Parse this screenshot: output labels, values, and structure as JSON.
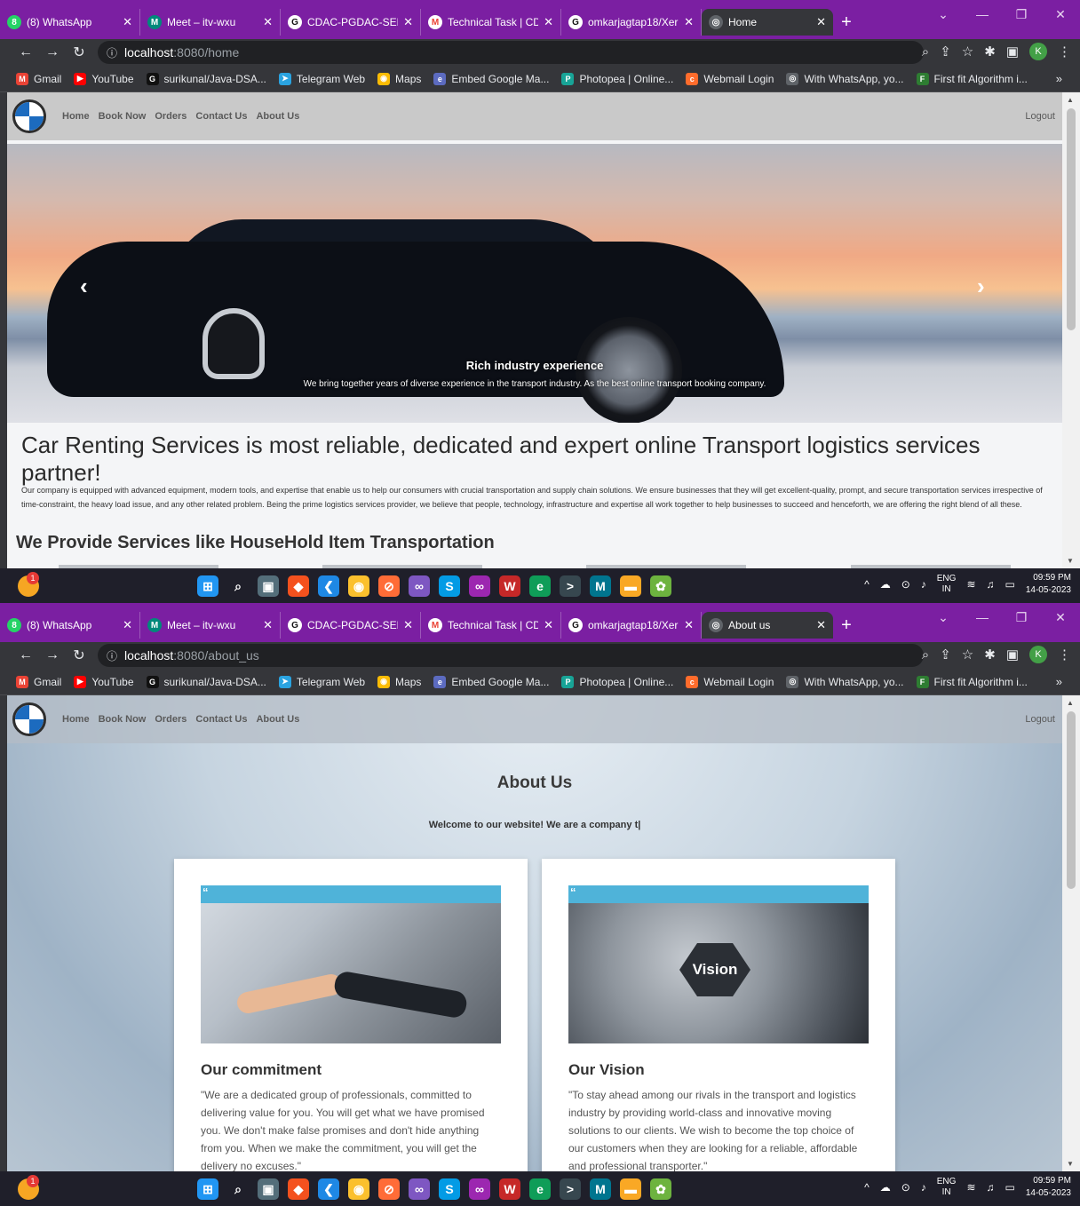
{
  "tabs": [
    {
      "title": "(8) WhatsApp",
      "icon": "whatsapp-icon",
      "color": "#25d366",
      "glyph": "8"
    },
    {
      "title": "Meet – itv-wxu",
      "icon": "meet-icon",
      "color": "#00897b",
      "glyph": "M"
    },
    {
      "title": "CDAC-PGDAC-SEPT",
      "icon": "github-icon",
      "color": "#111111",
      "glyph": "G"
    },
    {
      "title": "Technical Task | CD",
      "icon": "gmail-icon",
      "color": "#ea4335",
      "glyph": "M"
    },
    {
      "title": "omkarjagtap18/Xer",
      "icon": "github-icon",
      "color": "#111111",
      "glyph": "G"
    }
  ],
  "screens": {
    "home": {
      "active_tab": "Home",
      "url_host": "localhost",
      "url_path": ":8080/home"
    },
    "about": {
      "active_tab": "About us",
      "url_host": "localhost",
      "url_path": ":8080/about_us"
    }
  },
  "bookmarks": [
    {
      "label": "Gmail",
      "icon": "gmail-icon",
      "color": "#ea4335",
      "glyph": "M"
    },
    {
      "label": "YouTube",
      "icon": "youtube-icon",
      "color": "#ff0000",
      "glyph": "▶"
    },
    {
      "label": "surikunal/Java-DSA...",
      "icon": "github-icon",
      "color": "#111111",
      "glyph": "G"
    },
    {
      "label": "Telegram Web",
      "icon": "telegram-icon",
      "color": "#2aa3e0",
      "glyph": "➤"
    },
    {
      "label": "Maps",
      "icon": "maps-icon",
      "color": "#fbbc05",
      "glyph": "◉"
    },
    {
      "label": "Embed Google Ma...",
      "icon": "embed-icon",
      "color": "#5c6bc0",
      "glyph": "e"
    },
    {
      "label": "Photopea | Online...",
      "icon": "photopea-icon",
      "color": "#18a497",
      "glyph": "P"
    },
    {
      "label": "Webmail Login",
      "icon": "cpanel-icon",
      "color": "#ff6c2c",
      "glyph": "c"
    },
    {
      "label": "With WhatsApp, yo...",
      "icon": "globe-icon",
      "color": "#5f6368",
      "glyph": "◎"
    },
    {
      "label": "First fit Algorithm i...",
      "icon": "firstfit-icon",
      "color": "#2e7d32",
      "glyph": "F"
    }
  ],
  "site_nav": {
    "links": [
      "Home",
      "Book Now",
      "Orders",
      "Contact Us",
      "About Us"
    ],
    "logout": "Logout"
  },
  "home": {
    "carousel_title": "Rich industry experience",
    "carousel_text": "We bring together years of diverse experience in the transport industry. As the best online transport booking company.",
    "headline": "Car Renting Services is most reliable, dedicated and expert online Transport logistics services partner!",
    "paragraph": "Our company is equipped with advanced equipment, modern tools, and expertise that enable us to help our consumers with crucial transportation and supply chain solutions. We ensure businesses that they will get excellent-quality, prompt, and secure transportation services irrespective of time-constraint, the heavy load issue, and any other related problem. Being the prime logistics services provider, we believe that people, technology, infrastructure and expertise all work together to help businesses to succeed and henceforth, we are offering the right blend of all these.",
    "services_heading": "We Provide Services like HouseHold Item Transportation"
  },
  "about": {
    "title": "About Us",
    "welcome": "Welcome to our website! We are a company t|",
    "cards": [
      {
        "heading": "Our commitment",
        "text": "\"We are a dedicated group of professionals, committed to delivering value for you. You will get what we have promised you. We don't make false promises and don't hide anything from you. When we make the commitment, you will get the delivery no excuses.\""
      },
      {
        "heading": "Our Vision",
        "text": "\"To stay ahead among our rivals in the transport and logistics industry by providing world-class and innovative moving solutions to our clients. We wish to become the top choice of our customers when they are looking for a reliable, affordable and professional transporter.\"",
        "image_label": "Vision"
      }
    ]
  },
  "taskbar": {
    "badge": "1",
    "lang_top": "ENG",
    "lang_bottom": "IN",
    "time": "09:59 PM",
    "date": "14-05-2023",
    "icons": [
      {
        "name": "windows-start-icon",
        "color": "#2196f3",
        "glyph": "⊞"
      },
      {
        "name": "search-icon",
        "color": "transparent",
        "glyph": "⌕"
      },
      {
        "name": "task-view-icon",
        "color": "#546e7a",
        "glyph": "▣"
      },
      {
        "name": "git-icon",
        "color": "#f4511e",
        "glyph": "◆"
      },
      {
        "name": "vscode-icon",
        "color": "#1e88e5",
        "glyph": "❮"
      },
      {
        "name": "chrome-icon",
        "color": "#fbc02d",
        "glyph": "◉"
      },
      {
        "name": "postman-icon",
        "color": "#ff6c37",
        "glyph": "⊘"
      },
      {
        "name": "visual-studio-icon",
        "color": "#7e57c2",
        "glyph": "∞"
      },
      {
        "name": "skype-icon",
        "color": "#039be5",
        "glyph": "S"
      },
      {
        "name": "vs-preview-icon",
        "color": "#9c27b0",
        "glyph": "∞"
      },
      {
        "name": "wamp-icon",
        "color": "#c62828",
        "glyph": "W"
      },
      {
        "name": "edge-icon",
        "color": "#0f9d58",
        "glyph": "e"
      },
      {
        "name": "terminal-icon",
        "color": "#37474f",
        "glyph": ">"
      },
      {
        "name": "mysql-workbench-icon",
        "color": "#00758f",
        "glyph": "M"
      },
      {
        "name": "file-explorer-icon",
        "color": "#f9a825",
        "glyph": "▬"
      },
      {
        "name": "spring-tool-icon",
        "color": "#6db33f",
        "glyph": "✿"
      }
    ]
  }
}
